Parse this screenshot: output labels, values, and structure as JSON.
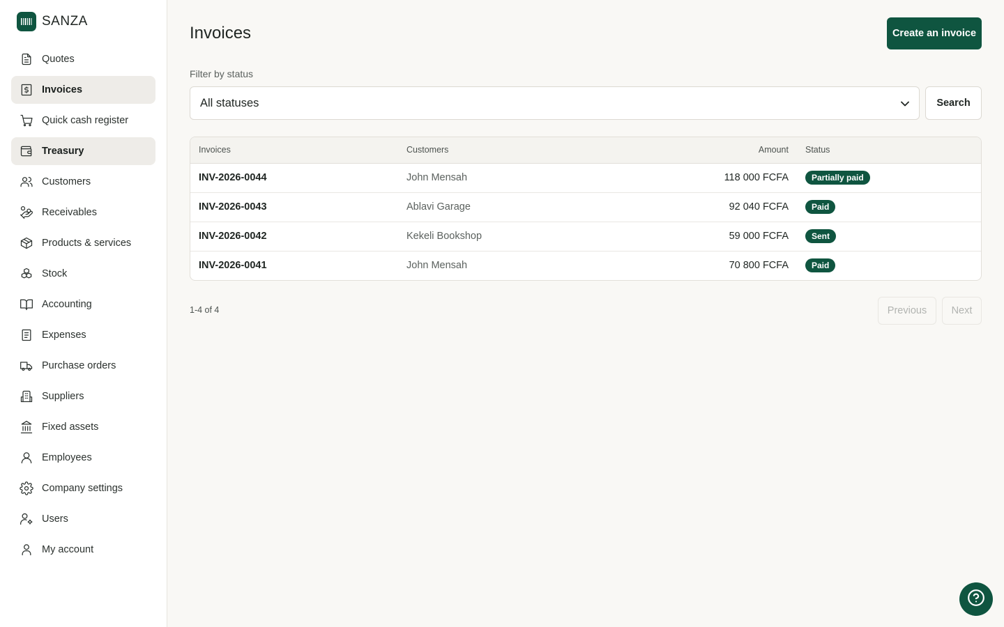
{
  "brand": {
    "name": "SANZA",
    "logo_icon": "barcode-icon",
    "accent_color": "#0f5540"
  },
  "sidebar": {
    "items": [
      {
        "label": "Quotes",
        "icon": "file-text-icon",
        "active": false
      },
      {
        "label": "Invoices",
        "icon": "dollar-file-icon",
        "active": true
      },
      {
        "label": "Quick cash register",
        "icon": "shopping-cart-icon",
        "active": false
      },
      {
        "label": "Treasury",
        "icon": "wallet-icon",
        "active": true
      },
      {
        "label": "Customers",
        "icon": "users-icon",
        "active": false
      },
      {
        "label": "Receivables",
        "icon": "hand-coins-icon",
        "active": false
      },
      {
        "label": "Products & services",
        "icon": "package-icon",
        "active": false
      },
      {
        "label": "Stock",
        "icon": "boxes-icon",
        "active": false
      },
      {
        "label": "Accounting",
        "icon": "book-open-icon",
        "active": false
      },
      {
        "label": "Expenses",
        "icon": "receipt-icon",
        "active": false
      },
      {
        "label": "Purchase orders",
        "icon": "truck-icon",
        "active": false
      },
      {
        "label": "Suppliers",
        "icon": "building-icon",
        "active": false
      },
      {
        "label": "Fixed assets",
        "icon": "landmark-icon",
        "active": false
      },
      {
        "label": "Employees",
        "icon": "user-round-icon",
        "active": false
      },
      {
        "label": "Company settings",
        "icon": "gear-icon",
        "active": false
      },
      {
        "label": "Users",
        "icon": "user-cog-icon",
        "active": false
      },
      {
        "label": "My account",
        "icon": "user-icon",
        "active": false
      }
    ]
  },
  "main": {
    "title": "Invoices",
    "create_button": "Create an invoice",
    "filter": {
      "label": "Filter by status",
      "selected": "All statuses",
      "search_button": "Search"
    },
    "table": {
      "headers": {
        "invoice": "Invoices",
        "customer": "Customers",
        "amount": "Amount",
        "status": "Status"
      },
      "rows": [
        {
          "invoice": "INV-2026-0044",
          "customer": "John Mensah",
          "amount": "118 000 FCFA",
          "status": "Partially paid"
        },
        {
          "invoice": "INV-2026-0043",
          "customer": "Ablavi Garage",
          "amount": "92 040 FCFA",
          "status": "Paid"
        },
        {
          "invoice": "INV-2026-0042",
          "customer": "Kekeli Bookshop",
          "amount": "59 000 FCFA",
          "status": "Sent"
        },
        {
          "invoice": "INV-2026-0041",
          "customer": "John Mensah",
          "amount": "70 800 FCFA",
          "status": "Paid"
        }
      ]
    },
    "pagination": {
      "range": "1-4 of 4",
      "previous": "Previous",
      "next": "Next"
    }
  },
  "help_button": {
    "icon": "help-circle-icon"
  }
}
